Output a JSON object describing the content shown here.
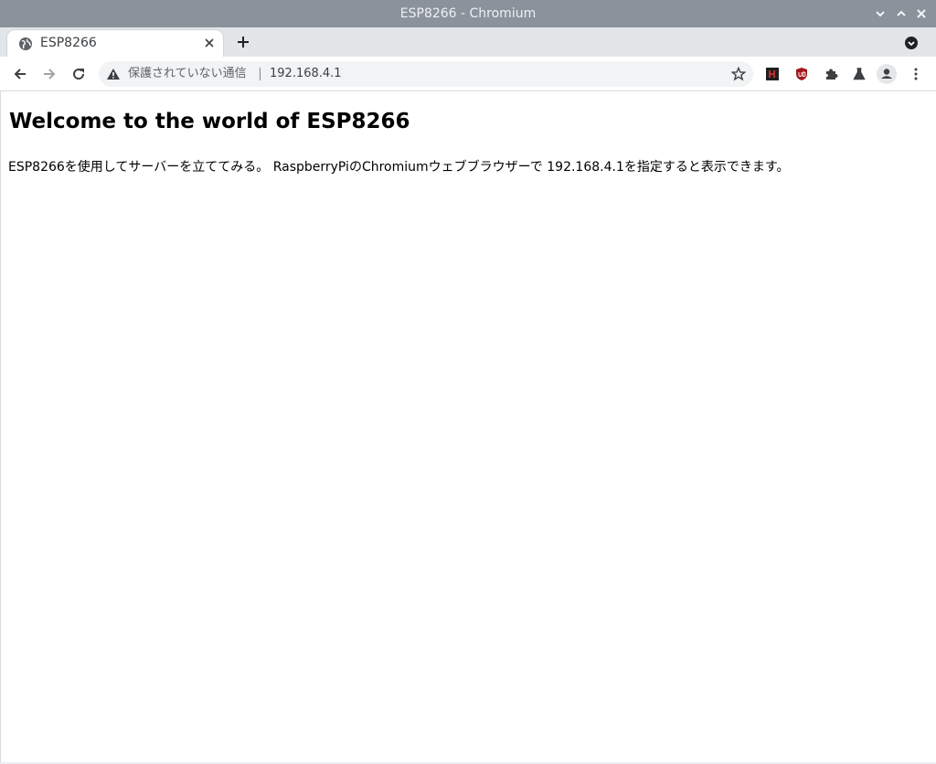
{
  "window": {
    "title": "ESP8266 - Chromium"
  },
  "tab": {
    "title": "ESP8266",
    "favicon": "globe-icon"
  },
  "toolbar": {
    "security_label": "保護されていない通信",
    "url": "192.168.4.1"
  },
  "page": {
    "heading": "Welcome to the world of ESP8266",
    "paragraph": "ESP8266を使用してサーバーを立ててみる。 RaspberryPiのChromiumウェブブラウザーで 192.168.4.1を指定すると表示できます。"
  },
  "colors": {
    "titlebar": "#8a939b",
    "tabstrip": "#e3e6e9",
    "omnibox": "#f1f3f4"
  }
}
